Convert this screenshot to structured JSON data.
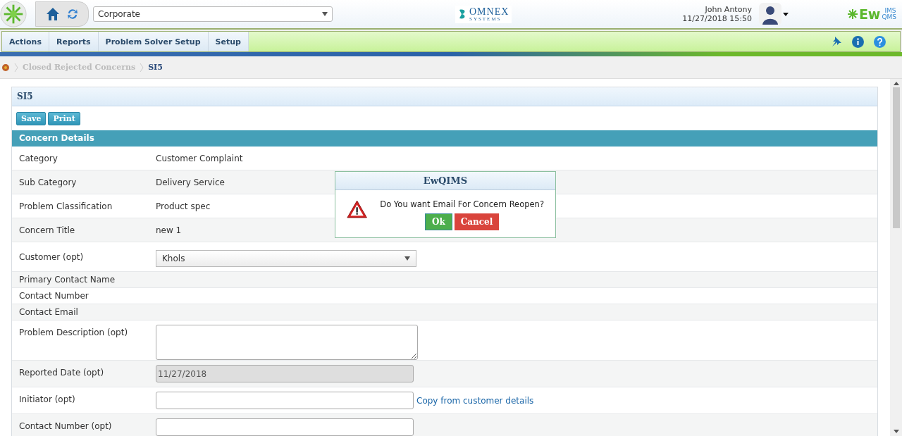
{
  "header": {
    "site": "Corporate",
    "brand": "OMNEX",
    "brand_sub": "SYSTEMS",
    "user": "John Antony",
    "datetime": "11/27/2018 15:50",
    "product": "Ew",
    "product_sup": "IMS",
    "product_sub": "QMS"
  },
  "menu": [
    "Actions",
    "Reports",
    "Problem Solver Setup",
    "Setup"
  ],
  "breadcrumb": [
    {
      "label": "Closed Rejected Concerns",
      "selected": false
    },
    {
      "label": "SI5",
      "selected": true
    }
  ],
  "panel": {
    "title": "SI5",
    "buttons": [
      "Save",
      "Print"
    ],
    "section": "Concern Details"
  },
  "rows": [
    {
      "label": "Category",
      "kind": "text",
      "value": "Customer Complaint"
    },
    {
      "label": "Sub Category",
      "kind": "text",
      "value": "Delivery Service"
    },
    {
      "label": "Problem Classification",
      "kind": "text",
      "value": "Product spec"
    },
    {
      "label": "Concern Title",
      "kind": "text",
      "value": "new 1"
    },
    {
      "label": "Customer (opt)",
      "kind": "select",
      "value": "Khols"
    },
    {
      "label": "Primary Contact Name",
      "kind": "plain"
    },
    {
      "label": "Contact Number",
      "kind": "plain"
    },
    {
      "label": "Contact Email",
      "kind": "plain"
    },
    {
      "label": "Problem Description (opt)",
      "kind": "textarea"
    },
    {
      "label": "Reported Date (opt)",
      "kind": "input",
      "value": "11/27/2018",
      "disabled": true
    },
    {
      "label": "Initiator (opt)",
      "kind": "input",
      "disabled": false,
      "link": "Copy from customer details"
    },
    {
      "label": "Contact Number (opt)",
      "kind": "input",
      "disabled": false
    }
  ],
  "dialog": {
    "title": "EwQIMS",
    "message": "Do You want Email For Concern Reopen?",
    "buttons": [
      {
        "label": "Ok",
        "kind": "ok"
      },
      {
        "label": "Cancel",
        "kind": "cancel"
      }
    ]
  }
}
